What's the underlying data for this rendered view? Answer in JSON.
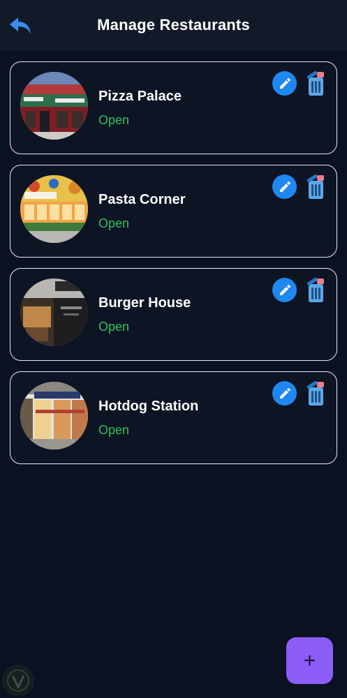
{
  "header": {
    "title": "Manage Restaurants",
    "back_icon": "undo-arrow-icon"
  },
  "restaurants": [
    {
      "name": "Pizza Palace",
      "status": "Open",
      "image": "pizza-storefront"
    },
    {
      "name": "Pasta Corner",
      "status": "Open",
      "image": "pasta-storefront"
    },
    {
      "name": "Burger House",
      "status": "Open",
      "image": "burger-storefront"
    },
    {
      "name": "Hotdog Station",
      "status": "Open",
      "image": "hotdog-storefront"
    }
  ],
  "actions": {
    "edit_icon": "pencil-icon",
    "delete_icon": "trash-icon"
  },
  "fab": {
    "label": "+",
    "icon": "plus-icon"
  },
  "colors": {
    "background": "#0b1120",
    "header": "#121a2a",
    "card_border": "#e8ebf2",
    "status_open": "#2fc15f",
    "edit": "#1e88f0",
    "fab": "#8b5cf6"
  }
}
